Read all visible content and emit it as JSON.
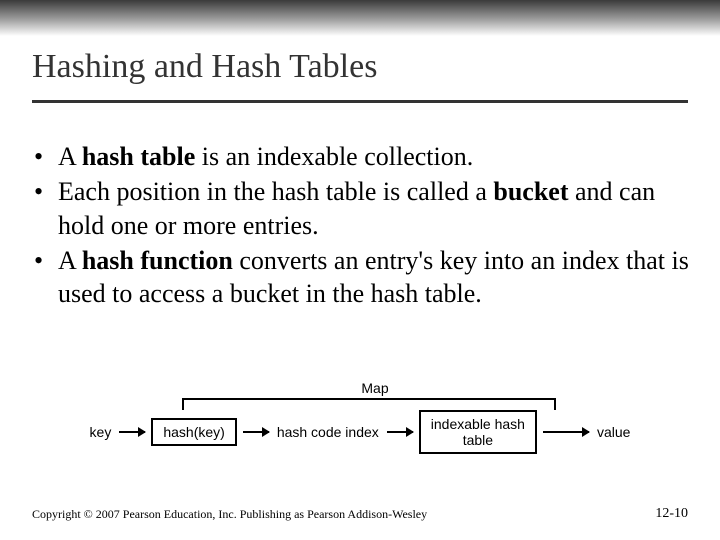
{
  "slide": {
    "title": "Hashing and Hash Tables",
    "bullets": [
      {
        "pre": "A ",
        "bold": "hash table",
        "post": " is an indexable collection."
      },
      {
        "pre": "Each position in the hash table is called a ",
        "bold": "bucket",
        "post": " and can hold one or more entries."
      },
      {
        "pre": "A ",
        "bold": "hash function",
        "post": " converts an entry's key into an index that is used to access a bucket in the hash table."
      }
    ]
  },
  "diagram": {
    "caption": "Map",
    "nodes": {
      "key": "key",
      "hash_fn": "hash(key)",
      "edge1": "hash code\nindex",
      "table": "indexable hash\ntable",
      "value": "value"
    }
  },
  "footer": {
    "copyright": "Copyright © 2007 Pearson Education, Inc. Publishing as Pearson Addison-Wesley",
    "page": "12-10"
  }
}
